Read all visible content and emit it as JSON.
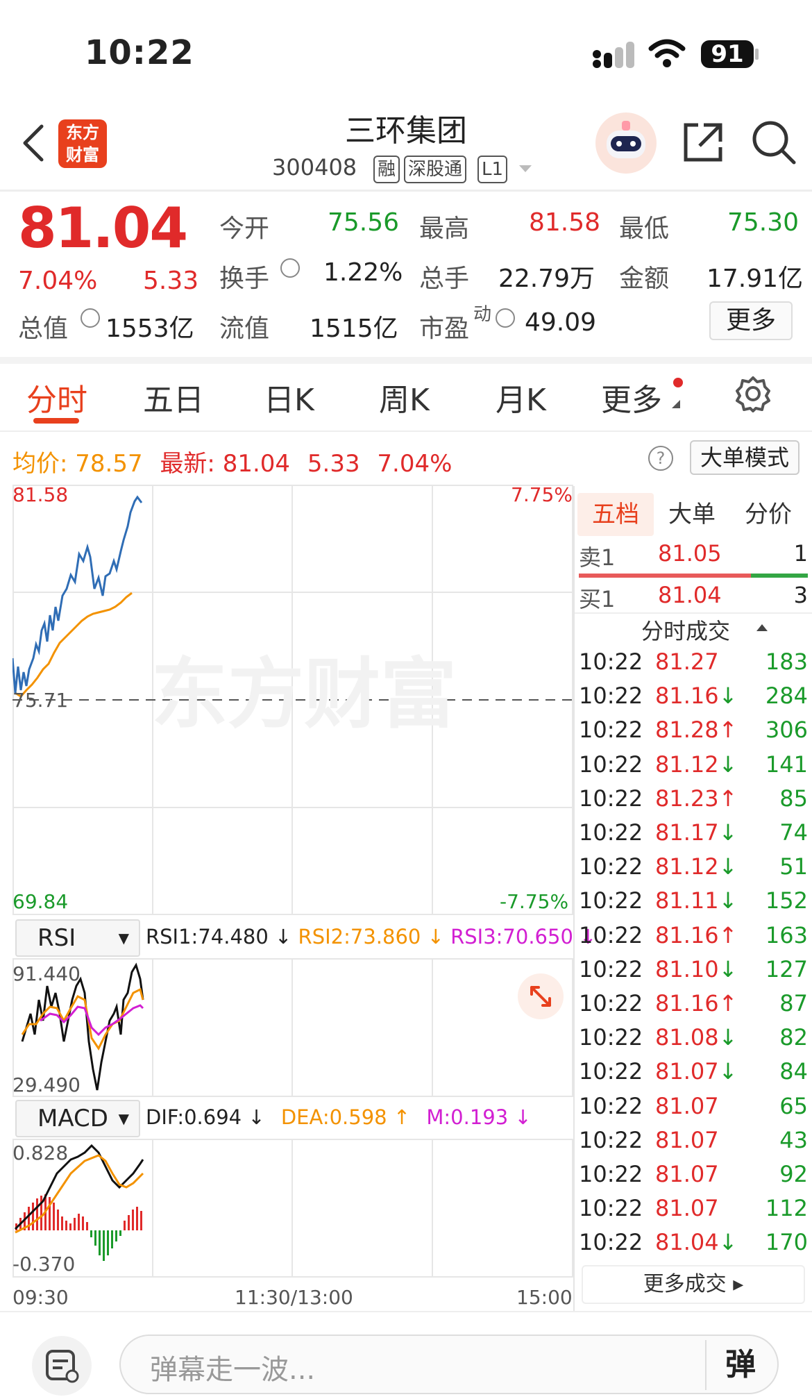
{
  "status_bar": {
    "time": "10:22",
    "battery": "91"
  },
  "header": {
    "logo_text": "东方财富",
    "name": "三环集团",
    "code": "300408",
    "tags": [
      "融",
      "深股通",
      "L1"
    ]
  },
  "quote": {
    "price": "81.04",
    "change_pct": "7.04%",
    "change": "5.33",
    "fields": [
      {
        "label": "今开",
        "value": "75.56"
      },
      {
        "label": "最高",
        "value": "81.58"
      },
      {
        "label": "最低",
        "value": "75.30"
      },
      {
        "label": "换手",
        "value": "1.22%"
      },
      {
        "label": "总手",
        "value": "22.79万"
      },
      {
        "label": "金额",
        "value": "17.91亿"
      },
      {
        "label": "总值",
        "value": "1553亿"
      },
      {
        "label": "流值",
        "value": "1515亿"
      },
      {
        "label": "市盈",
        "sup": "动",
        "value": "49.09"
      }
    ],
    "more_label": "更多"
  },
  "tabs": [
    "分时",
    "五日",
    "日K",
    "周K",
    "月K",
    "更多"
  ],
  "info": {
    "avg_label": "均价:",
    "avg_value": "78.57",
    "latest_label": "最新:",
    "latest_value": "81.04",
    "change": "5.33",
    "pct": "7.04%",
    "help": "?",
    "big_order_mode": "大单模式"
  },
  "main_chart": {
    "y_max": "81.58",
    "y_min": "69.84",
    "pct_max": "7.75%",
    "pct_min": "-7.75%",
    "prev_close": "75.71",
    "watermark": "东方财富"
  },
  "rsi": {
    "selector": "RSI",
    "rsi1": "RSI1:74.480 ↓",
    "rsi2": "RSI2:73.860 ↓",
    "rsi3": "RSI3:70.650 ↓",
    "y_max": "91.440",
    "y_min": "29.490"
  },
  "macd": {
    "selector": "MACD",
    "dif": "DIF:0.694 ↓",
    "dea": "DEA:0.598 ↑",
    "m": "M:0.193 ↓",
    "y_max": "0.828",
    "y_min": "-0.370"
  },
  "time_axis": {
    "start": "09:30",
    "mid": "11:30/13:00",
    "end": "15:00"
  },
  "order_book": {
    "tabs": [
      "五档",
      "大单",
      "分价"
    ],
    "sell1": {
      "label": "卖1",
      "price": "81.05",
      "vol": "1"
    },
    "buy1": {
      "label": "买1",
      "price": "81.04",
      "vol": "3"
    },
    "sell_ratio": 0.75,
    "trades_title": "分时成交",
    "trades": [
      {
        "time": "10:22",
        "price": "81.27",
        "arrow": "",
        "vol": "183"
      },
      {
        "time": "10:22",
        "price": "81.16",
        "arrow": "↓",
        "vol": "284"
      },
      {
        "time": "10:22",
        "price": "81.28",
        "arrow": "↑",
        "vol": "306"
      },
      {
        "time": "10:22",
        "price": "81.12",
        "arrow": "↓",
        "vol": "141"
      },
      {
        "time": "10:22",
        "price": "81.23",
        "arrow": "↑",
        "vol": "85"
      },
      {
        "time": "10:22",
        "price": "81.17",
        "arrow": "↓",
        "vol": "74"
      },
      {
        "time": "10:22",
        "price": "81.12",
        "arrow": "↓",
        "vol": "51"
      },
      {
        "time": "10:22",
        "price": "81.11",
        "arrow": "↓",
        "vol": "152"
      },
      {
        "time": "10:22",
        "price": "81.16",
        "arrow": "↑",
        "vol": "163"
      },
      {
        "time": "10:22",
        "price": "81.10",
        "arrow": "↓",
        "vol": "127"
      },
      {
        "time": "10:22",
        "price": "81.16",
        "arrow": "↑",
        "vol": "87"
      },
      {
        "time": "10:22",
        "price": "81.08",
        "arrow": "↓",
        "vol": "82"
      },
      {
        "time": "10:22",
        "price": "81.07",
        "arrow": "↓",
        "vol": "84"
      },
      {
        "time": "10:22",
        "price": "81.07",
        "arrow": "",
        "vol": "65"
      },
      {
        "time": "10:22",
        "price": "81.07",
        "arrow": "",
        "vol": "43"
      },
      {
        "time": "10:22",
        "price": "81.07",
        "arrow": "",
        "vol": "92"
      },
      {
        "time": "10:22",
        "price": "81.07",
        "arrow": "",
        "vol": "112"
      },
      {
        "time": "10:22",
        "price": "81.04",
        "arrow": "↓",
        "vol": "170"
      }
    ],
    "more_trades": "更多成交 ▸"
  },
  "bottom_bar": {
    "placeholder": "弹幕走一波...",
    "danmu_button": "弹"
  },
  "colors": {
    "up": "#e02a2a",
    "down": "#1a9a2a",
    "accent": "#e8401d",
    "price_line": "#2f6db5",
    "avg_line": "#f39200"
  }
}
